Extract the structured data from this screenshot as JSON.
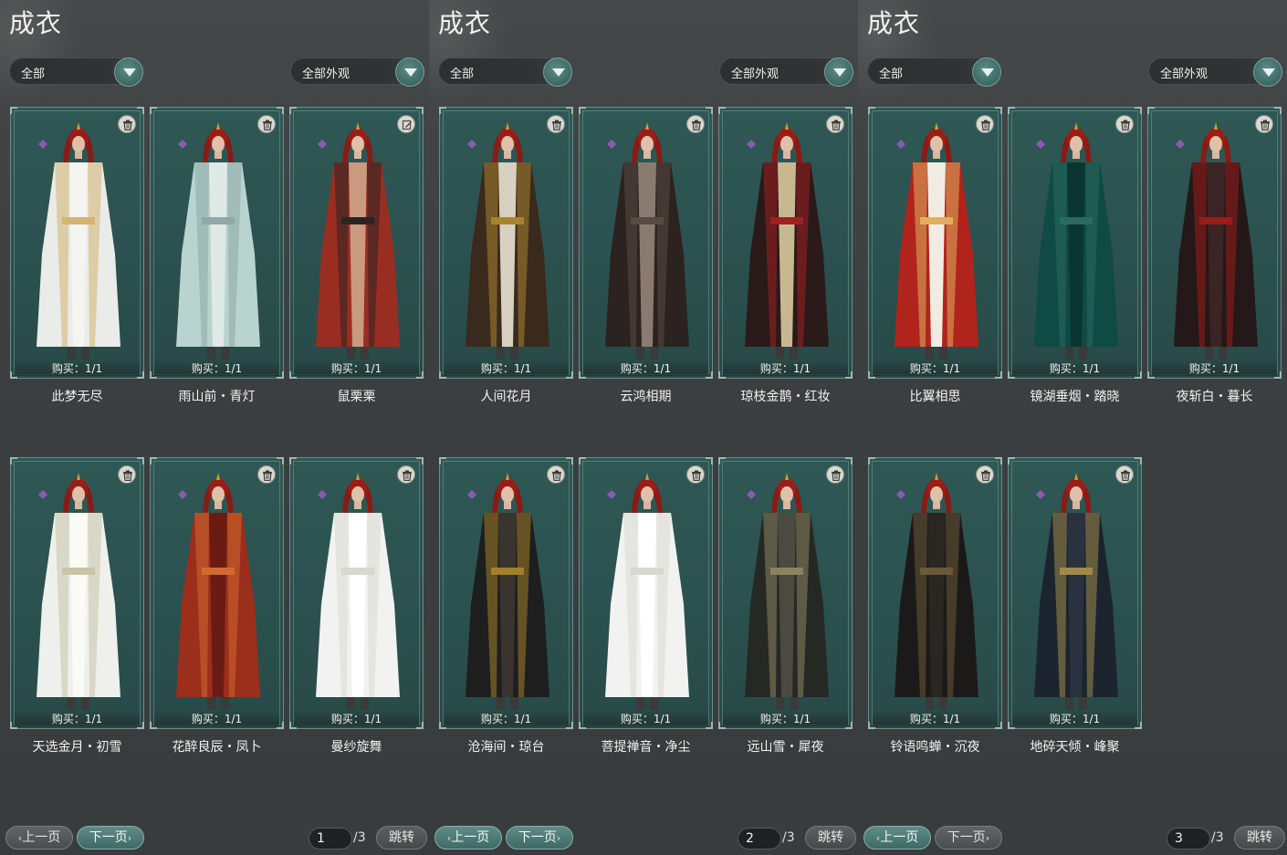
{
  "panels": [
    {
      "title": "成衣",
      "filter_category": "全部",
      "filter_appearance": "全部外观",
      "items": [
        {
          "name": "此梦无尽",
          "buy": "购买：1/1",
          "palette": "white-gold",
          "icon": "trash-icon"
        },
        {
          "name": "雨山前・青灯",
          "buy": "购买：1/1",
          "palette": "pale-teal",
          "icon": "trash-icon"
        },
        {
          "name": "鼠栗栗",
          "buy": "购买：1/1",
          "palette": "shirtless-red",
          "icon": "edit-icon"
        },
        {
          "name": "天选金月・初雪",
          "buy": "购买：1/1",
          "palette": "white-silver",
          "icon": "trash-icon"
        },
        {
          "name": "花醉良辰・凤卜",
          "buy": "购买：1/1",
          "palette": "crimson-orange",
          "icon": "trash-icon"
        },
        {
          "name": "曼纱旋舞",
          "buy": "购买：1/1",
          "palette": "white-gauze",
          "icon": "trash-icon"
        }
      ],
      "pager": {
        "prev": "上一页",
        "next": "下一页",
        "current": "1",
        "total": "/3",
        "jump": "跳转",
        "active": "next"
      }
    },
    {
      "title": "成衣",
      "filter_category": "全部",
      "filter_appearance": "全部外观",
      "items": [
        {
          "name": "人间花月",
          "buy": "购买：1/1",
          "palette": "brown-gold",
          "icon": "trash-icon"
        },
        {
          "name": "云鸿相期",
          "buy": "购买：1/1",
          "palette": "dark-brown",
          "icon": "trash-icon"
        },
        {
          "name": "琼枝金鹊・红妆",
          "buy": "购买：1/1",
          "palette": "black-red",
          "icon": "trash-icon"
        },
        {
          "name": "沧海间・琼台",
          "buy": "购买：1/1",
          "palette": "black-gold",
          "icon": "trash-icon"
        },
        {
          "name": "菩提禅音・净尘",
          "buy": "购买：1/1",
          "palette": "white-gauze",
          "icon": "trash-icon"
        },
        {
          "name": "远山雪・犀夜",
          "buy": "购买：1/1",
          "palette": "dark-olive",
          "icon": "trash-icon"
        }
      ],
      "pager": {
        "prev": "上一页",
        "next": "下一页",
        "current": "2",
        "total": "/3",
        "jump": "跳转",
        "active": "both"
      }
    },
    {
      "title": "成衣",
      "filter_category": "全部",
      "filter_appearance": "全部外观",
      "items": [
        {
          "name": "比翼相思",
          "buy": "购买：1/1",
          "palette": "red-white",
          "icon": "trash-icon"
        },
        {
          "name": "镜湖垂烟・踏晓",
          "buy": "购买：1/1",
          "palette": "emerald",
          "icon": "trash-icon"
        },
        {
          "name": "夜斩白・暮长",
          "buy": "购买：1/1",
          "palette": "black-crimson",
          "icon": "trash-icon"
        },
        {
          "name": "铃语鸣蝉・沉夜",
          "buy": "购买：1/1",
          "palette": "black-bronze",
          "icon": "trash-icon"
        },
        {
          "name": "地碎天倾・峰聚",
          "buy": "购买：1/1",
          "palette": "navy-gold",
          "icon": "trash-icon"
        }
      ],
      "pager": {
        "prev": "上一页",
        "next": "下一页",
        "current": "3",
        "total": "/3",
        "jump": "跳转",
        "active": "prev"
      }
    }
  ],
  "palettes": {
    "white-gold": {
      "robe": "#e9ece8",
      "trim": "#d4b470",
      "inner": "#f4f4f0"
    },
    "pale-teal": {
      "robe": "#b9d3cf",
      "trim": "#8ea9a6",
      "inner": "#dfe9e6"
    },
    "shirtless-red": {
      "robe": "#9a2d22",
      "trim": "#2a2422",
      "inner": "#c99a80"
    },
    "white-silver": {
      "robe": "#eef0ec",
      "trim": "#c8c4a8",
      "inner": "#fafaf6"
    },
    "crimson-orange": {
      "robe": "#9c2e1c",
      "trim": "#d06a30",
      "inner": "#6a1c14"
    },
    "white-gauze": {
      "robe": "#f2f3f0",
      "trim": "#d8d8d0",
      "inner": "#ffffff"
    },
    "brown-gold": {
      "robe": "#3a2a1e",
      "trim": "#a8842e",
      "inner": "#d8d0c0"
    },
    "dark-brown": {
      "robe": "#2c2220",
      "trim": "#5a4a44",
      "inner": "#8a7a70"
    },
    "black-red": {
      "robe": "#2a1a1a",
      "trim": "#a02020",
      "inner": "#c8b890"
    },
    "black-gold": {
      "robe": "#1e1e1e",
      "trim": "#a0802a",
      "inner": "#3a3430"
    },
    "dark-olive": {
      "robe": "#262824",
      "trim": "#8a8460",
      "inner": "#4a4a40"
    },
    "red-white": {
      "robe": "#b0241c",
      "trim": "#e0b060",
      "inner": "#f0ece4"
    },
    "emerald": {
      "robe": "#0f4a44",
      "trim": "#2a6a60",
      "inner": "#0a3632"
    },
    "black-crimson": {
      "robe": "#241818",
      "trim": "#9a1c1c",
      "inner": "#3a2424"
    },
    "black-bronze": {
      "robe": "#1c1a18",
      "trim": "#6a5a3a",
      "inner": "#2a2622"
    },
    "navy-gold": {
      "robe": "#1c2430",
      "trim": "#a08a4a",
      "inner": "#2a3240"
    }
  }
}
